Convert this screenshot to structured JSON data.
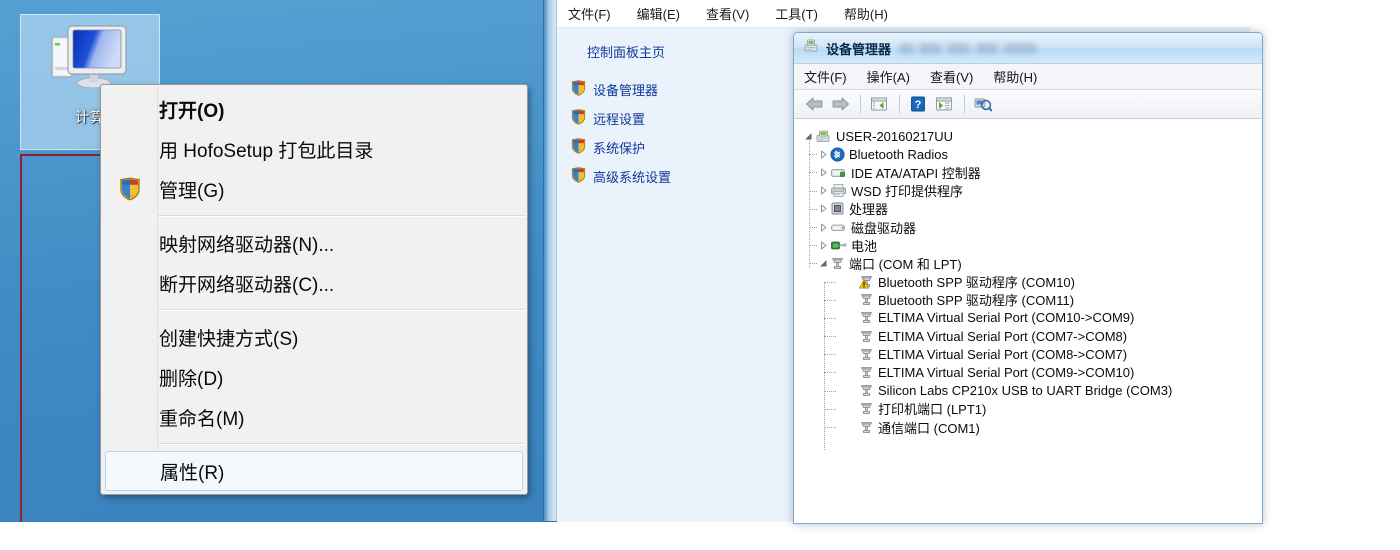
{
  "desktop": {
    "icon": {
      "name": "computer-icon",
      "label": "计算"
    }
  },
  "context_menu": {
    "items": [
      {
        "label": "打开(O)",
        "bold": true,
        "shield": false,
        "selected": false,
        "separator_after": false
      },
      {
        "label": "用 HofoSetup 打包此目录",
        "bold": false,
        "shield": false,
        "selected": false,
        "separator_after": false
      },
      {
        "label": "管理(G)",
        "bold": false,
        "shield": true,
        "selected": false,
        "separator_after": true
      },
      {
        "label": "映射网络驱动器(N)...",
        "bold": false,
        "shield": false,
        "selected": false,
        "separator_after": false
      },
      {
        "label": "断开网络驱动器(C)...",
        "bold": false,
        "shield": false,
        "selected": false,
        "separator_after": true
      },
      {
        "label": "创建快捷方式(S)",
        "bold": false,
        "shield": false,
        "selected": false,
        "separator_after": false
      },
      {
        "label": "删除(D)",
        "bold": false,
        "shield": false,
        "selected": false,
        "separator_after": false
      },
      {
        "label": "重命名(M)",
        "bold": false,
        "shield": false,
        "selected": false,
        "separator_after": true
      },
      {
        "label": "属性(R)",
        "bold": false,
        "shield": false,
        "selected": true,
        "separator_after": false
      }
    ]
  },
  "control_panel": {
    "menubar": [
      {
        "label": "文件(F)"
      },
      {
        "label": "编辑(E)"
      },
      {
        "label": "查看(V)"
      },
      {
        "label": "工具(T)"
      },
      {
        "label": "帮助(H)"
      }
    ],
    "home_link": "控制面板主页",
    "tasks": [
      {
        "label": "设备管理器",
        "icon": "shield-icon"
      },
      {
        "label": "远程设置",
        "icon": "shield-icon"
      },
      {
        "label": "系统保护",
        "icon": "shield-icon"
      },
      {
        "label": "高级系统设置",
        "icon": "shield-icon"
      }
    ]
  },
  "device_manager": {
    "title": "设备管理器",
    "menubar": [
      {
        "label": "文件(F)"
      },
      {
        "label": "操作(A)"
      },
      {
        "label": "查看(V)"
      },
      {
        "label": "帮助(H)"
      }
    ],
    "toolbar": [
      {
        "icon": "back-arrow-icon"
      },
      {
        "icon": "forward-arrow-icon"
      },
      {
        "icon": "separator"
      },
      {
        "icon": "show-hide-console-tree-icon"
      },
      {
        "icon": "separator2"
      },
      {
        "icon": "help-icon"
      },
      {
        "icon": "properties-icon"
      },
      {
        "icon": "separator3"
      },
      {
        "icon": "scan-hardware-changes-icon"
      }
    ],
    "tree": [
      {
        "level": 0,
        "label": "USER-20160217UU",
        "icon": "computer-node-icon",
        "expander": "expanded",
        "warning": false
      },
      {
        "level": 1,
        "label": "Bluetooth Radios",
        "icon": "bluetooth-icon",
        "expander": "collapsed",
        "warning": false
      },
      {
        "level": 1,
        "label": "IDE ATA/ATAPI 控制器",
        "icon": "ide-controller-icon",
        "expander": "collapsed",
        "warning": false
      },
      {
        "level": 1,
        "label": "WSD 打印提供程序",
        "icon": "printer-icon",
        "expander": "collapsed",
        "warning": false
      },
      {
        "level": 1,
        "label": "处理器",
        "icon": "processor-icon",
        "expander": "collapsed",
        "warning": false
      },
      {
        "level": 1,
        "label": "磁盘驱动器",
        "icon": "disk-drive-icon",
        "expander": "collapsed",
        "warning": false
      },
      {
        "level": 1,
        "label": "电池",
        "icon": "battery-icon",
        "expander": "collapsed",
        "warning": false
      },
      {
        "level": 1,
        "label": "端口 (COM 和 LPT)",
        "icon": "port-icon",
        "expander": "expanded",
        "warning": false
      },
      {
        "level": 2,
        "label": "Bluetooth SPP 驱动程序 (COM10)",
        "icon": "port-icon",
        "expander": "none",
        "warning": true
      },
      {
        "level": 2,
        "label": "Bluetooth SPP 驱动程序 (COM11)",
        "icon": "port-icon",
        "expander": "none",
        "warning": false
      },
      {
        "level": 2,
        "label": "ELTIMA Virtual Serial Port (COM10->COM9)",
        "icon": "port-icon",
        "expander": "none",
        "warning": false
      },
      {
        "level": 2,
        "label": "ELTIMA Virtual Serial Port (COM7->COM8)",
        "icon": "port-icon",
        "expander": "none",
        "warning": false
      },
      {
        "level": 2,
        "label": "ELTIMA Virtual Serial Port (COM8->COM7)",
        "icon": "port-icon",
        "expander": "none",
        "warning": false
      },
      {
        "level": 2,
        "label": "ELTIMA Virtual Serial Port (COM9->COM10)",
        "icon": "port-icon",
        "expander": "none",
        "warning": false
      },
      {
        "level": 2,
        "label": "Silicon Labs CP210x USB to UART Bridge (COM3)",
        "icon": "port-icon",
        "expander": "none",
        "warning": false
      },
      {
        "level": 2,
        "label": "打印机端口 (LPT1)",
        "icon": "port-icon",
        "expander": "none",
        "warning": false
      },
      {
        "level": 2,
        "label": "通信端口 (COM1)",
        "icon": "port-icon",
        "expander": "none",
        "warning": false
      }
    ]
  },
  "colors": {
    "desktop_blue": "#4a92c8",
    "menu_bg": "#f1f1f1",
    "selection_border": "#b5d4ee",
    "link_blue": "#11399b",
    "titlebar_blue": "#b9dcf6",
    "crop_marker_red": "#e21d1d"
  }
}
